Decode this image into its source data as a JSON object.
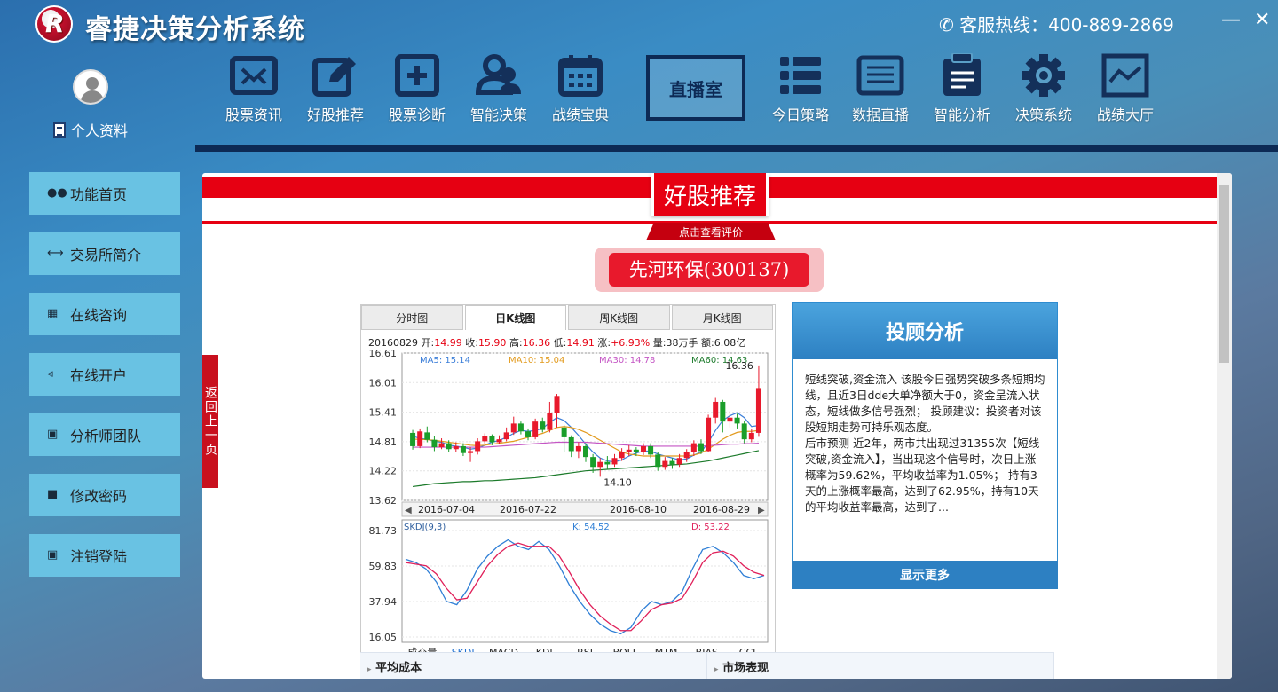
{
  "app": {
    "title": "睿捷决策分析系统",
    "hotline": "客服热线：400-889-2869",
    "minimize": "—",
    "close": "✕"
  },
  "profile": {
    "label": "个人资料"
  },
  "nav": {
    "items": [
      {
        "label": "股票资讯",
        "icon": "mail-icon"
      },
      {
        "label": "好股推荐",
        "icon": "edit-icon"
      },
      {
        "label": "股票诊断",
        "icon": "plus-square-icon"
      },
      {
        "label": "智能决策",
        "icon": "users-icon"
      },
      {
        "label": "战绩宝典",
        "icon": "calendar-icon"
      },
      {
        "label": "今日策略",
        "icon": "list-icon"
      },
      {
        "label": "数据直播",
        "icon": "document-icon"
      },
      {
        "label": "智能分析",
        "icon": "clipboard-icon"
      },
      {
        "label": "决策系统",
        "icon": "gear-icon"
      },
      {
        "label": "战绩大厅",
        "icon": "line-chart-icon"
      }
    ],
    "live": "直播室"
  },
  "sidebar": {
    "items": [
      {
        "label": "功能首页",
        "icon": "users-icon"
      },
      {
        "label": "交易所简介",
        "icon": "handshake-icon"
      },
      {
        "label": "在线咨询",
        "icon": "chat-icon"
      },
      {
        "label": "在线开户",
        "icon": "speaker-icon"
      },
      {
        "label": "分析师团队",
        "icon": "monitor-icon"
      },
      {
        "label": "修改密码",
        "icon": "lock-icon"
      },
      {
        "label": "注销登陆",
        "icon": "monitor-icon"
      }
    ]
  },
  "main": {
    "banner": "好股推荐",
    "ribbon": "点击查看评价",
    "stock": "先河环保(300137)",
    "back": "返回上一页"
  },
  "chart_tabs": [
    "分时图",
    "日K线图",
    "周K线图",
    "月K线图"
  ],
  "quote": {
    "date": "20160829",
    "open_label": "开:",
    "open": "14.99",
    "close_label": "收:",
    "close": "15.90",
    "high_label": "高:",
    "high": "16.36",
    "low_label": "低:",
    "low": "14.91",
    "change_label": "涨:",
    "change": "+6.93%",
    "volume_label": "量:",
    "volume": "38万手",
    "amount_label": "额:",
    "amount": "6.08亿"
  },
  "chart_data": [
    {
      "type": "candlestick",
      "ylim": [
        13.62,
        16.61
      ],
      "yticks": [
        "16.61",
        "16.01",
        "15.41",
        "14.81",
        "14.22",
        "13.62"
      ],
      "xticks": [
        "2016-07-04",
        "2016-07-22",
        "2016-08-10",
        "2016-08-29"
      ],
      "ma_legend": [
        {
          "label": "MA5: 15.14",
          "color": "#3b7ed8"
        },
        {
          "label": "MA10: 15.04",
          "color": "#e29a1d"
        },
        {
          "label": "MA30: 14.78",
          "color": "#c455c4"
        },
        {
          "label": "MA60: 14.63",
          "color": "#1b7a2a"
        }
      ],
      "annotations": [
        "16.36",
        "14.10"
      ],
      "candles": [
        [
          14.99,
          14.72,
          15.05,
          14.65
        ],
        [
          14.72,
          15.02,
          15.08,
          14.68
        ],
        [
          15.0,
          14.85,
          15.12,
          14.8
        ],
        [
          14.85,
          14.7,
          14.92,
          14.62
        ],
        [
          14.7,
          14.78,
          14.88,
          14.66
        ],
        [
          14.78,
          14.66,
          14.84,
          14.6
        ],
        [
          14.66,
          14.72,
          14.8,
          14.6
        ],
        [
          14.72,
          14.58,
          14.78,
          14.52
        ],
        [
          14.58,
          14.62,
          14.7,
          14.4
        ],
        [
          14.62,
          14.82,
          14.88,
          14.55
        ],
        [
          14.82,
          14.92,
          14.98,
          14.76
        ],
        [
          14.92,
          14.8,
          14.96,
          14.74
        ],
        [
          14.8,
          14.86,
          14.94,
          14.76
        ],
        [
          14.86,
          15.0,
          15.1,
          14.82
        ],
        [
          15.0,
          15.18,
          15.32,
          14.95
        ],
        [
          15.18,
          15.02,
          15.22,
          14.96
        ],
        [
          15.02,
          14.9,
          15.08,
          14.84
        ],
        [
          14.9,
          15.22,
          15.28,
          14.86
        ],
        [
          15.22,
          15.05,
          15.3,
          15.0
        ],
        [
          15.05,
          15.4,
          15.62,
          15.0
        ],
        [
          15.4,
          15.74,
          15.78,
          15.1
        ],
        [
          15.1,
          14.9,
          15.15,
          14.6
        ],
        [
          14.9,
          14.62,
          14.94,
          14.5
        ],
        [
          14.62,
          14.72,
          14.8,
          14.48
        ],
        [
          14.72,
          14.5,
          14.78,
          14.4
        ],
        [
          14.5,
          14.3,
          14.56,
          14.18
        ],
        [
          14.3,
          14.4,
          14.48,
          14.1
        ],
        [
          14.4,
          14.35,
          14.52,
          14.26
        ],
        [
          14.35,
          14.48,
          14.56,
          14.3
        ],
        [
          14.48,
          14.6,
          14.68,
          14.42
        ],
        [
          14.6,
          14.65,
          14.74,
          14.52
        ],
        [
          14.65,
          14.6,
          14.7,
          14.52
        ],
        [
          14.6,
          14.72,
          14.78,
          14.54
        ],
        [
          14.72,
          14.55,
          14.78,
          14.48
        ],
        [
          14.55,
          14.3,
          14.6,
          14.22
        ],
        [
          14.3,
          14.42,
          14.5,
          14.24
        ],
        [
          14.42,
          14.35,
          14.48,
          14.26
        ],
        [
          14.35,
          14.48,
          14.56,
          14.3
        ],
        [
          14.48,
          14.6,
          14.66,
          14.4
        ],
        [
          14.6,
          14.78,
          14.84,
          14.52
        ],
        [
          14.78,
          14.62,
          14.86,
          14.56
        ],
        [
          14.62,
          15.3,
          15.36,
          14.6
        ],
        [
          15.3,
          15.62,
          15.7,
          15.18
        ],
        [
          15.62,
          15.22,
          15.66,
          15.0
        ],
        [
          15.22,
          15.3,
          15.44,
          15.1
        ],
        [
          15.3,
          15.18,
          15.38,
          15.08
        ],
        [
          15.18,
          14.86,
          15.24,
          14.78
        ],
        [
          14.86,
          14.99,
          15.06,
          14.8
        ],
        [
          14.99,
          15.9,
          16.36,
          14.91
        ]
      ],
      "ma_series": [
        {
          "name": "MA5",
          "values": [
            14.92,
            14.88,
            14.86,
            14.82,
            14.8,
            14.74,
            14.72,
            14.7,
            14.66,
            14.68,
            14.74,
            14.8,
            14.84,
            14.9,
            14.98,
            15.04,
            15.02,
            15.04,
            15.08,
            15.2,
            15.3,
            15.24,
            15.1,
            14.94,
            14.76,
            14.6,
            14.48,
            14.42,
            14.4,
            14.44,
            14.52,
            14.58,
            14.62,
            14.62,
            14.56,
            14.52,
            14.48,
            14.44,
            14.46,
            14.54,
            14.6,
            14.8,
            15.04,
            15.24,
            15.34,
            15.4,
            15.3,
            15.12,
            15.14
          ]
        },
        {
          "name": "MA10",
          "values": [
            14.86,
            14.86,
            14.85,
            14.84,
            14.82,
            14.8,
            14.78,
            14.76,
            14.74,
            14.73,
            14.74,
            14.76,
            14.78,
            14.8,
            14.82,
            14.86,
            14.9,
            14.94,
            14.98,
            15.04,
            15.1,
            15.12,
            15.1,
            15.06,
            15.0,
            14.92,
            14.84,
            14.76,
            14.68,
            14.6,
            14.56,
            14.54,
            14.52,
            14.52,
            14.52,
            14.52,
            14.52,
            14.52,
            14.52,
            14.54,
            14.58,
            14.66,
            14.76,
            14.86,
            14.94,
            15.0,
            15.02,
            15.02,
            15.04
          ]
        },
        {
          "name": "MA30",
          "values": [
            14.7,
            14.7,
            14.7,
            14.7,
            14.7,
            14.7,
            14.7,
            14.7,
            14.7,
            14.7,
            14.7,
            14.71,
            14.72,
            14.73,
            14.74,
            14.75,
            14.76,
            14.77,
            14.78,
            14.79,
            14.8,
            14.8,
            14.8,
            14.8,
            14.8,
            14.79,
            14.78,
            14.77,
            14.76,
            14.75,
            14.74,
            14.73,
            14.72,
            14.72,
            14.72,
            14.72,
            14.72,
            14.72,
            14.72,
            14.72,
            14.72,
            14.73,
            14.74,
            14.75,
            14.76,
            14.76,
            14.77,
            14.77,
            14.78
          ]
        },
        {
          "name": "MA60",
          "values": [
            13.9,
            13.92,
            13.94,
            13.96,
            13.97,
            13.98,
            13.99,
            14.0,
            14.0,
            14.01,
            14.02,
            14.02,
            14.03,
            14.04,
            14.05,
            14.06,
            14.07,
            14.08,
            14.1,
            14.12,
            14.14,
            14.16,
            14.18,
            14.2,
            14.22,
            14.23,
            14.24,
            14.25,
            14.26,
            14.27,
            14.28,
            14.29,
            14.3,
            14.31,
            14.32,
            14.33,
            14.34,
            14.35,
            14.36,
            14.38,
            14.4,
            14.42,
            14.45,
            14.48,
            14.51,
            14.54,
            14.57,
            14.6,
            14.63
          ]
        }
      ]
    },
    {
      "type": "line",
      "title": "SKDJ(9,3)",
      "ylim": [
        16.05,
        81.73
      ],
      "yticks": [
        "81.73",
        "59.83",
        "37.94",
        "16.05"
      ],
      "legend": [
        {
          "label": "K: 54.52",
          "color": "#2f7fd6"
        },
        {
          "label": "D: 53.22",
          "color": "#e0205a"
        }
      ],
      "series": [
        {
          "name": "K",
          "color": "#2f7fd6",
          "values": [
            64,
            62,
            58,
            50,
            38,
            36,
            45,
            58,
            66,
            72,
            76,
            72,
            70,
            75,
            70,
            60,
            48,
            38,
            30,
            24,
            20,
            18,
            22,
            32,
            38,
            36,
            38,
            44,
            58,
            70,
            72,
            68,
            62,
            54,
            52,
            54
          ]
        },
        {
          "name": "D",
          "color": "#e0205a",
          "values": [
            62,
            61,
            60,
            55,
            46,
            39,
            40,
            50,
            60,
            67,
            72,
            74,
            72,
            72,
            72,
            66,
            56,
            45,
            36,
            29,
            24,
            20,
            20,
            26,
            33,
            36,
            37,
            40,
            50,
            62,
            68,
            69,
            66,
            60,
            56,
            54
          ]
        }
      ],
      "indicator_tabs": [
        "成交量",
        "SKDJ",
        "MACD",
        "KDJ",
        "RSI",
        "BOLL",
        "MTM",
        "BIAS",
        "CCI"
      ]
    }
  ],
  "advisor": {
    "title": "投顾分析",
    "body": "短线突破,资金流入 该股今日强势突破多条短期均线，且近3日dde大单净额大于0，资金呈流入状态，短线做多信号强烈； 投顾建议：投资者对该股短期走势可持乐观态度。\n后市预测 近2年，两市共出现过31355次【短线突破,资金流入】，当出现这个信号时，次日上涨概率为59.62%，平均收益率为1.05%； 持有3天的上涨概率最高，达到了62.95%，持有10天的平均收益率最高，达到了...",
    "more": "显示更多"
  },
  "bottom": {
    "left": "平均成本",
    "right": "市场表现"
  },
  "colors": {
    "accent_red": "#e60012",
    "sidebar_btn": "#69c2e3",
    "nav_dark": "#0d2a55",
    "up": "#e8192c",
    "down": "#1a9e2a"
  }
}
